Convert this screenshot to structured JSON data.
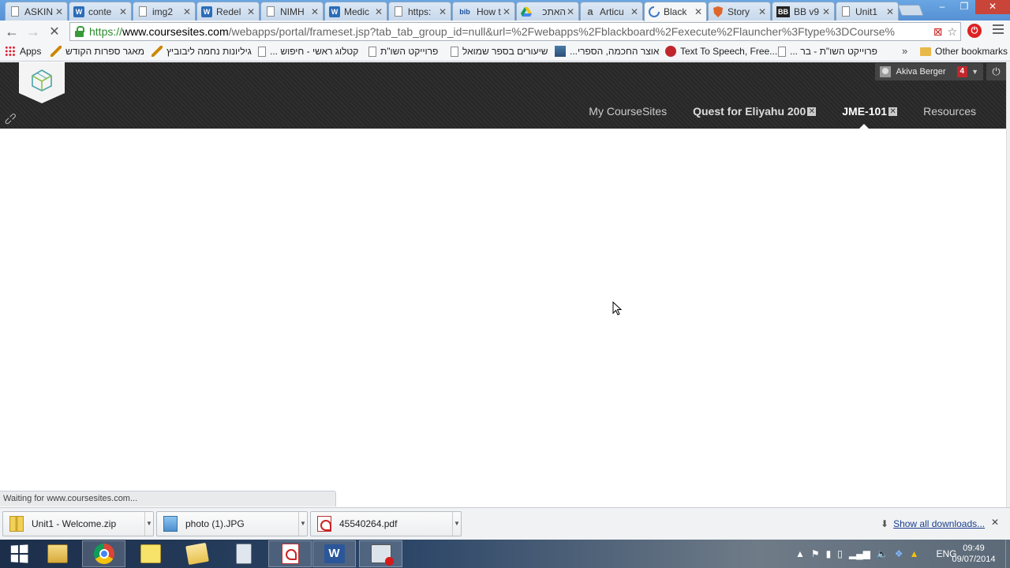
{
  "browser": {
    "tabs": [
      {
        "title": "ASKIN",
        "icon": "page-icon"
      },
      {
        "title": "conte",
        "icon": "wp-icon"
      },
      {
        "title": "img2",
        "icon": "page-icon"
      },
      {
        "title": "Redel",
        "icon": "wp-icon"
      },
      {
        "title": "NIMH",
        "icon": "page-icon"
      },
      {
        "title": "Medic",
        "icon": "wp-icon"
      },
      {
        "title": "https:",
        "icon": "page-icon"
      },
      {
        "title": "How t",
        "icon": "bib-icon",
        "fav_text": "bib"
      },
      {
        "title": "האתכ",
        "icon": "drive-icon"
      },
      {
        "title": "Articu",
        "icon": "a-icon"
      },
      {
        "title": "Black",
        "icon": "loading-icon",
        "active": true
      },
      {
        "title": "Story",
        "icon": "shield-icon"
      },
      {
        "title": "BB v9",
        "icon": "bb-icon",
        "fav_text": "BB"
      },
      {
        "title": "Unit1",
        "icon": "page-icon"
      }
    ],
    "address": {
      "scheme": "https://",
      "host": "www.coursesites.com",
      "path": "/webapps/portal/frameset.jsp?tab_tab_group_id=null&url=%2Fwebapps%2Fblackboard%2Fexecute%2Flauncher%3Ftype%3DCourse%"
    },
    "bookmarks": [
      {
        "label": "Apps",
        "icon": "apps-icon"
      },
      {
        "label": "מאגר ספרות הקודש",
        "icon": "quill-icon"
      },
      {
        "label": "גיליונות נחמה ליבוביץ",
        "icon": "quill-icon"
      },
      {
        "label": "קטלוג ראשי - חיפוש ...",
        "icon": "page-icon"
      },
      {
        "label": "פרוייקט השו\"ת",
        "icon": "page-icon"
      },
      {
        "label": "שיעורים בספר שמואל",
        "icon": "page-icon"
      },
      {
        "label": "אוצר החכמה, הספרי...",
        "icon": "book-icon"
      },
      {
        "label": "Text To Speech, Free...",
        "icon": "tts-icon"
      },
      {
        "label": "פרוייקט השו\"ת - בר ...",
        "icon": "page-icon"
      }
    ],
    "other_bookmarks": "Other bookmarks",
    "chevron": "»",
    "status": "Waiting for www.coursesites.com..."
  },
  "site": {
    "user": {
      "name": "Akiva Berger",
      "notifications": "4"
    },
    "nav": [
      {
        "label": "My CourseSites",
        "closable": false
      },
      {
        "label": "Quest for Eliyahu 200",
        "closable": true
      },
      {
        "label": "JME-101",
        "closable": true,
        "current": true
      },
      {
        "label": "Resources",
        "closable": false
      }
    ]
  },
  "downloads": {
    "items": [
      {
        "name": "Unit1 - Welcome.zip",
        "icon": "zip-icon"
      },
      {
        "name": "photo (1).JPG",
        "icon": "image-icon"
      },
      {
        "name": "45540264.pdf",
        "icon": "pdf-icon"
      }
    ],
    "show_all": "Show all downloads...",
    "close": "✕"
  },
  "taskbar": {
    "language": "ENG",
    "time": "09:49",
    "date": "09/07/2014"
  },
  "colors": {
    "header_bg": "#2b2b2b",
    "notification": "#c0272d",
    "secure_green": "#2d8a2d"
  }
}
